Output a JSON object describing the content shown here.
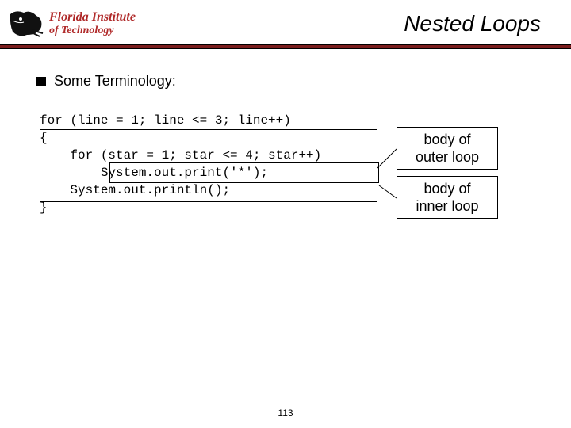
{
  "header": {
    "institution_line1": "Florida Institute",
    "institution_line2": "of Technology",
    "slide_title": "Nested Loops"
  },
  "bullet": {
    "text": "Some Terminology:"
  },
  "code": {
    "l1": "for (line = 1; line <= 3; line++)",
    "l2": "{",
    "l3": "    for (star = 1; star <= 4; star++)",
    "l4": "        System.out.print('*');",
    "l5": "    System.out.println();",
    "l6": "}"
  },
  "callouts": {
    "outer_line1": "body of",
    "outer_line2": "outer loop",
    "inner_line1": "body of",
    "inner_line2": "inner loop"
  },
  "page_number": "113"
}
